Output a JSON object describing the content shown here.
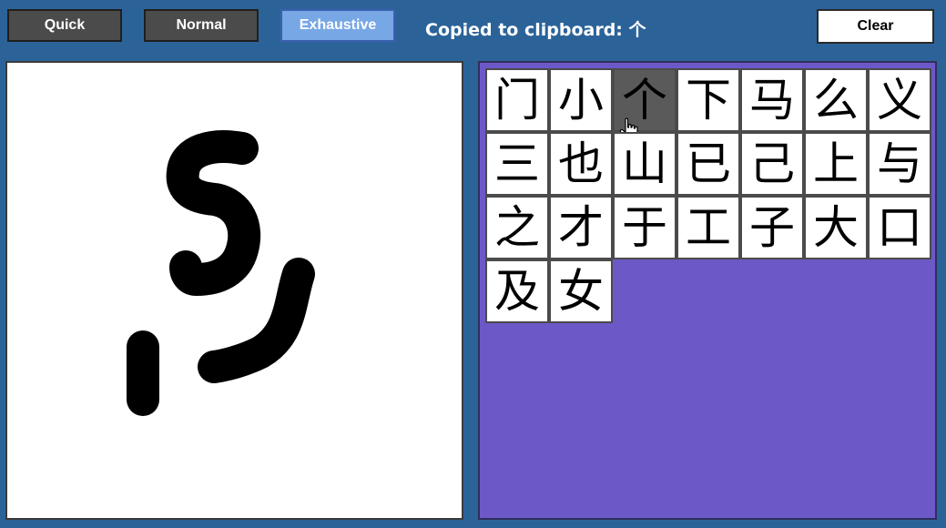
{
  "toolbar": {
    "quick_label": "Quick",
    "normal_label": "Normal",
    "exhaustive_label": "Exhaustive",
    "active_mode": "Exhaustive",
    "clear_label": "Clear"
  },
  "status": {
    "text": "Copied to clipboard: 个"
  },
  "results": {
    "characters": [
      "门",
      "小",
      "个",
      "下",
      "马",
      "么",
      "义",
      "三",
      "也",
      "山",
      "已",
      "己",
      "上",
      "与",
      "之",
      "才",
      "于",
      "工",
      "子",
      "大",
      "口",
      "及",
      "女"
    ],
    "hovered_index": 2
  },
  "colors": {
    "background": "#2b6399",
    "mode_button": "#4b4b4b",
    "mode_button_active": "#78a7e6",
    "results_panel": "#6d58c8",
    "hover_cell": "#5a5a5a",
    "ink": "#000000"
  },
  "icons": {
    "cursor": "hand-pointer-icon"
  }
}
